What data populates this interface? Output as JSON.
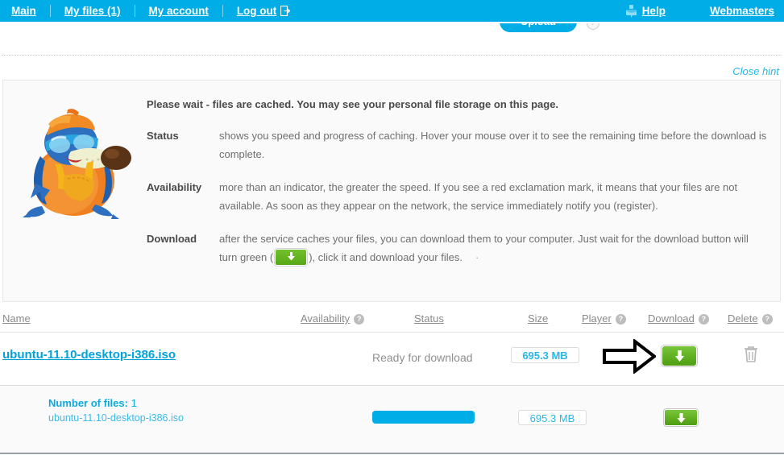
{
  "nav": {
    "left_items": [
      {
        "label": "Main",
        "name": "nav-main"
      },
      {
        "label": "My files (1)",
        "name": "nav-my-files"
      },
      {
        "label": "My account",
        "name": "nav-my-account"
      },
      {
        "label": "Log out",
        "name": "nav-log-out"
      }
    ],
    "logout_icon": "logout-icon",
    "help_label": "Help",
    "help_icon": "help-chat-icon",
    "webmasters_label": "Webmasters",
    "bar_color": "#00ade6"
  },
  "upload": {
    "label": "Upload",
    "help_badge": "?"
  },
  "hint": {
    "close_label": "Close hint",
    "mascot_icon": "mascot-mole-icon",
    "title": "Please wait - files are cached. You may see your personal file storage on this page.",
    "rows": [
      {
        "term": "Status",
        "text": "shows you speed and progress of caching. Hover your mouse over it to see the remaining time before the download is complete."
      },
      {
        "term": "Availability",
        "text": "more than an indicator, the greater the speed. If you see a red exclamation mark, it means that your files are not available. As soon as they appear on the network, the service immediately notify you (register)."
      }
    ],
    "download_term": "Download",
    "download_text_before": "after the service caches your files, you can download them to your computer. Just wait for the download button will turn green (",
    "download_text_after": "), click it and download your files.",
    "download_trailing_dot": "·"
  },
  "table": {
    "headers": {
      "name": "Name",
      "availability": "Availability",
      "status": "Status",
      "size": "Size",
      "player": "Player",
      "download": "Download",
      "delete": "Delete"
    },
    "help_badge": "?",
    "row": {
      "name": "ubuntu-11.10-desktop-i386.iso",
      "status": "Ready for download",
      "size": "695.3 MB",
      "download_icon": "download-arrow-icon",
      "delete_icon": "trash-icon",
      "pointer_icon": "annotation-arrow-icon"
    }
  },
  "summary": {
    "files_label": "Number of files:",
    "files_count": "1",
    "file_name": "ubuntu-11.10-desktop-i386.iso",
    "size": "695.3 MB",
    "progress_percent": 100,
    "download_icon": "download-arrow-icon"
  },
  "colors": {
    "brand_blue": "#00ade6",
    "link_blue": "#00a2dd",
    "green_button": "#62b223",
    "panel_bg": "#fafafa"
  }
}
